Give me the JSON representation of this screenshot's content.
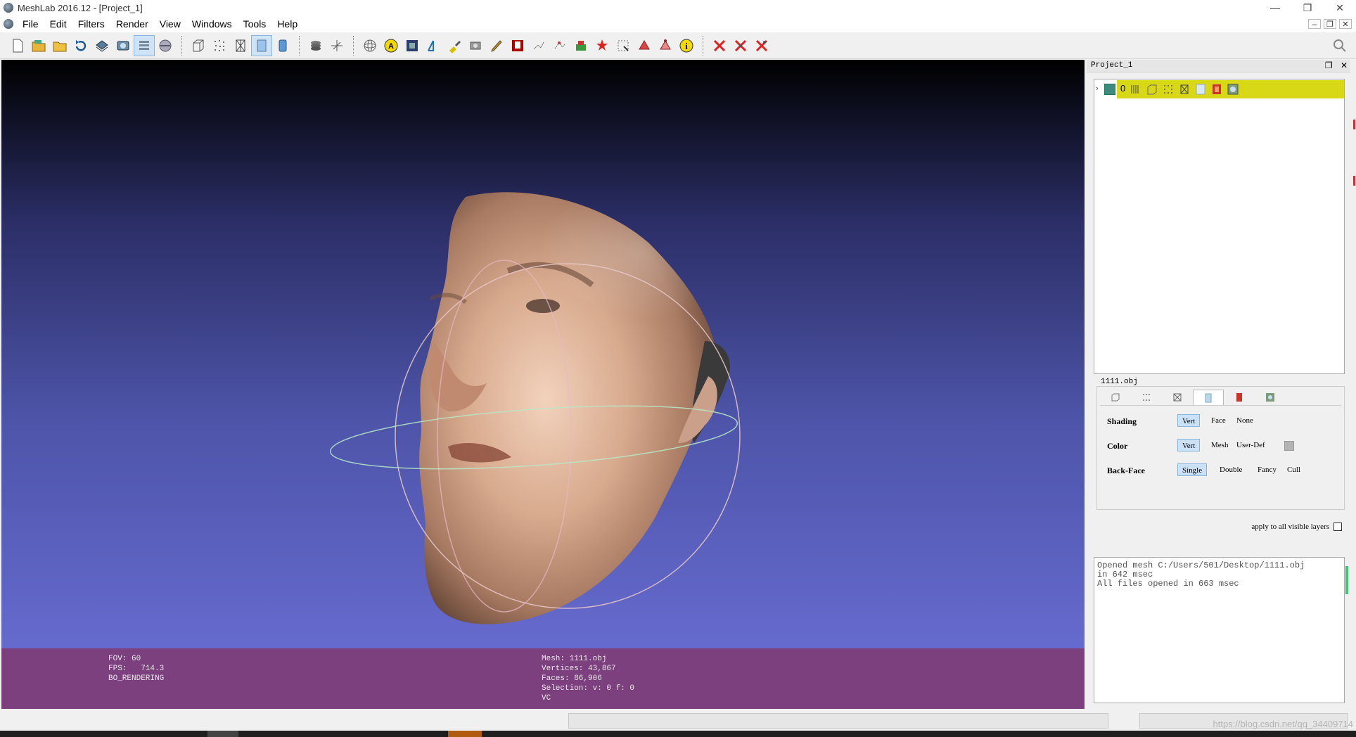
{
  "window": {
    "title": "MeshLab 2016.12 - [Project_1]",
    "controls": [
      "—",
      "❐",
      "✕"
    ],
    "mdi_controls": [
      "–",
      "❐",
      "✕"
    ]
  },
  "menu": [
    "File",
    "Edit",
    "Filters",
    "Render",
    "View",
    "Windows",
    "Tools",
    "Help"
  ],
  "toolbar_icons": [
    "new-project-icon",
    "open-project-icon",
    "import-mesh-icon",
    "reload-icon",
    "export-mesh-icon",
    "snapshot-icon",
    "layers-icon",
    "view-layers-icon",
    "bounding-box-icon",
    "points-icon",
    "wireframe-icon",
    "flat-shading-icon",
    "smooth-shading-icon",
    "stack-icon",
    "axis-icon",
    "trackball-icon",
    "annotation-icon",
    "texture-icon",
    "measure-icon",
    "paint-icon",
    "capture-icon",
    "brush-icon",
    "color-map-icon",
    "align-icon",
    "pick-points-icon",
    "edit-icon",
    "georef-icon",
    "select-icon",
    "select-faces-icon",
    "select-vertices-icon",
    "info-icon",
    "delete-selection-icon",
    "delete-faces-icon",
    "delete-vertices-icon"
  ],
  "viewport": {
    "info_left": [
      "FOV: 60",
      "FPS:   714.3",
      "BO_RENDERING"
    ],
    "info_right": [
      "Mesh: 1111.obj",
      "Vertices: 43,867",
      "Faces: 86,906",
      "Selection: v: 0 f: 0",
      "VC"
    ]
  },
  "dock": {
    "title": "Project_1",
    "layer": {
      "id": "0"
    },
    "layer_name": "1111.obj",
    "shading": {
      "label": "Shading",
      "options": [
        "Vert",
        "Face",
        "None"
      ],
      "selected": "Vert"
    },
    "color": {
      "label": "Color",
      "options": [
        "Vert",
        "Mesh",
        "User-Def"
      ],
      "selected": "Vert"
    },
    "backface": {
      "label": "Back-Face",
      "options": [
        "Single",
        "Double",
        "Fancy",
        "Cull"
      ],
      "selected": "Single"
    },
    "apply_all": "apply to all visible layers",
    "log": [
      "Opened mesh C:/Users/501/Desktop/1111.obj",
      "in 642 msec",
      "All files opened in 663 msec"
    ]
  },
  "status": {
    "watermark": "https://blog.csdn.net/qq_34409714"
  },
  "colors": {
    "info_bar": "#7c407e",
    "layer_highlight": "#d8d816",
    "selected_option": "#cbe1f7"
  }
}
